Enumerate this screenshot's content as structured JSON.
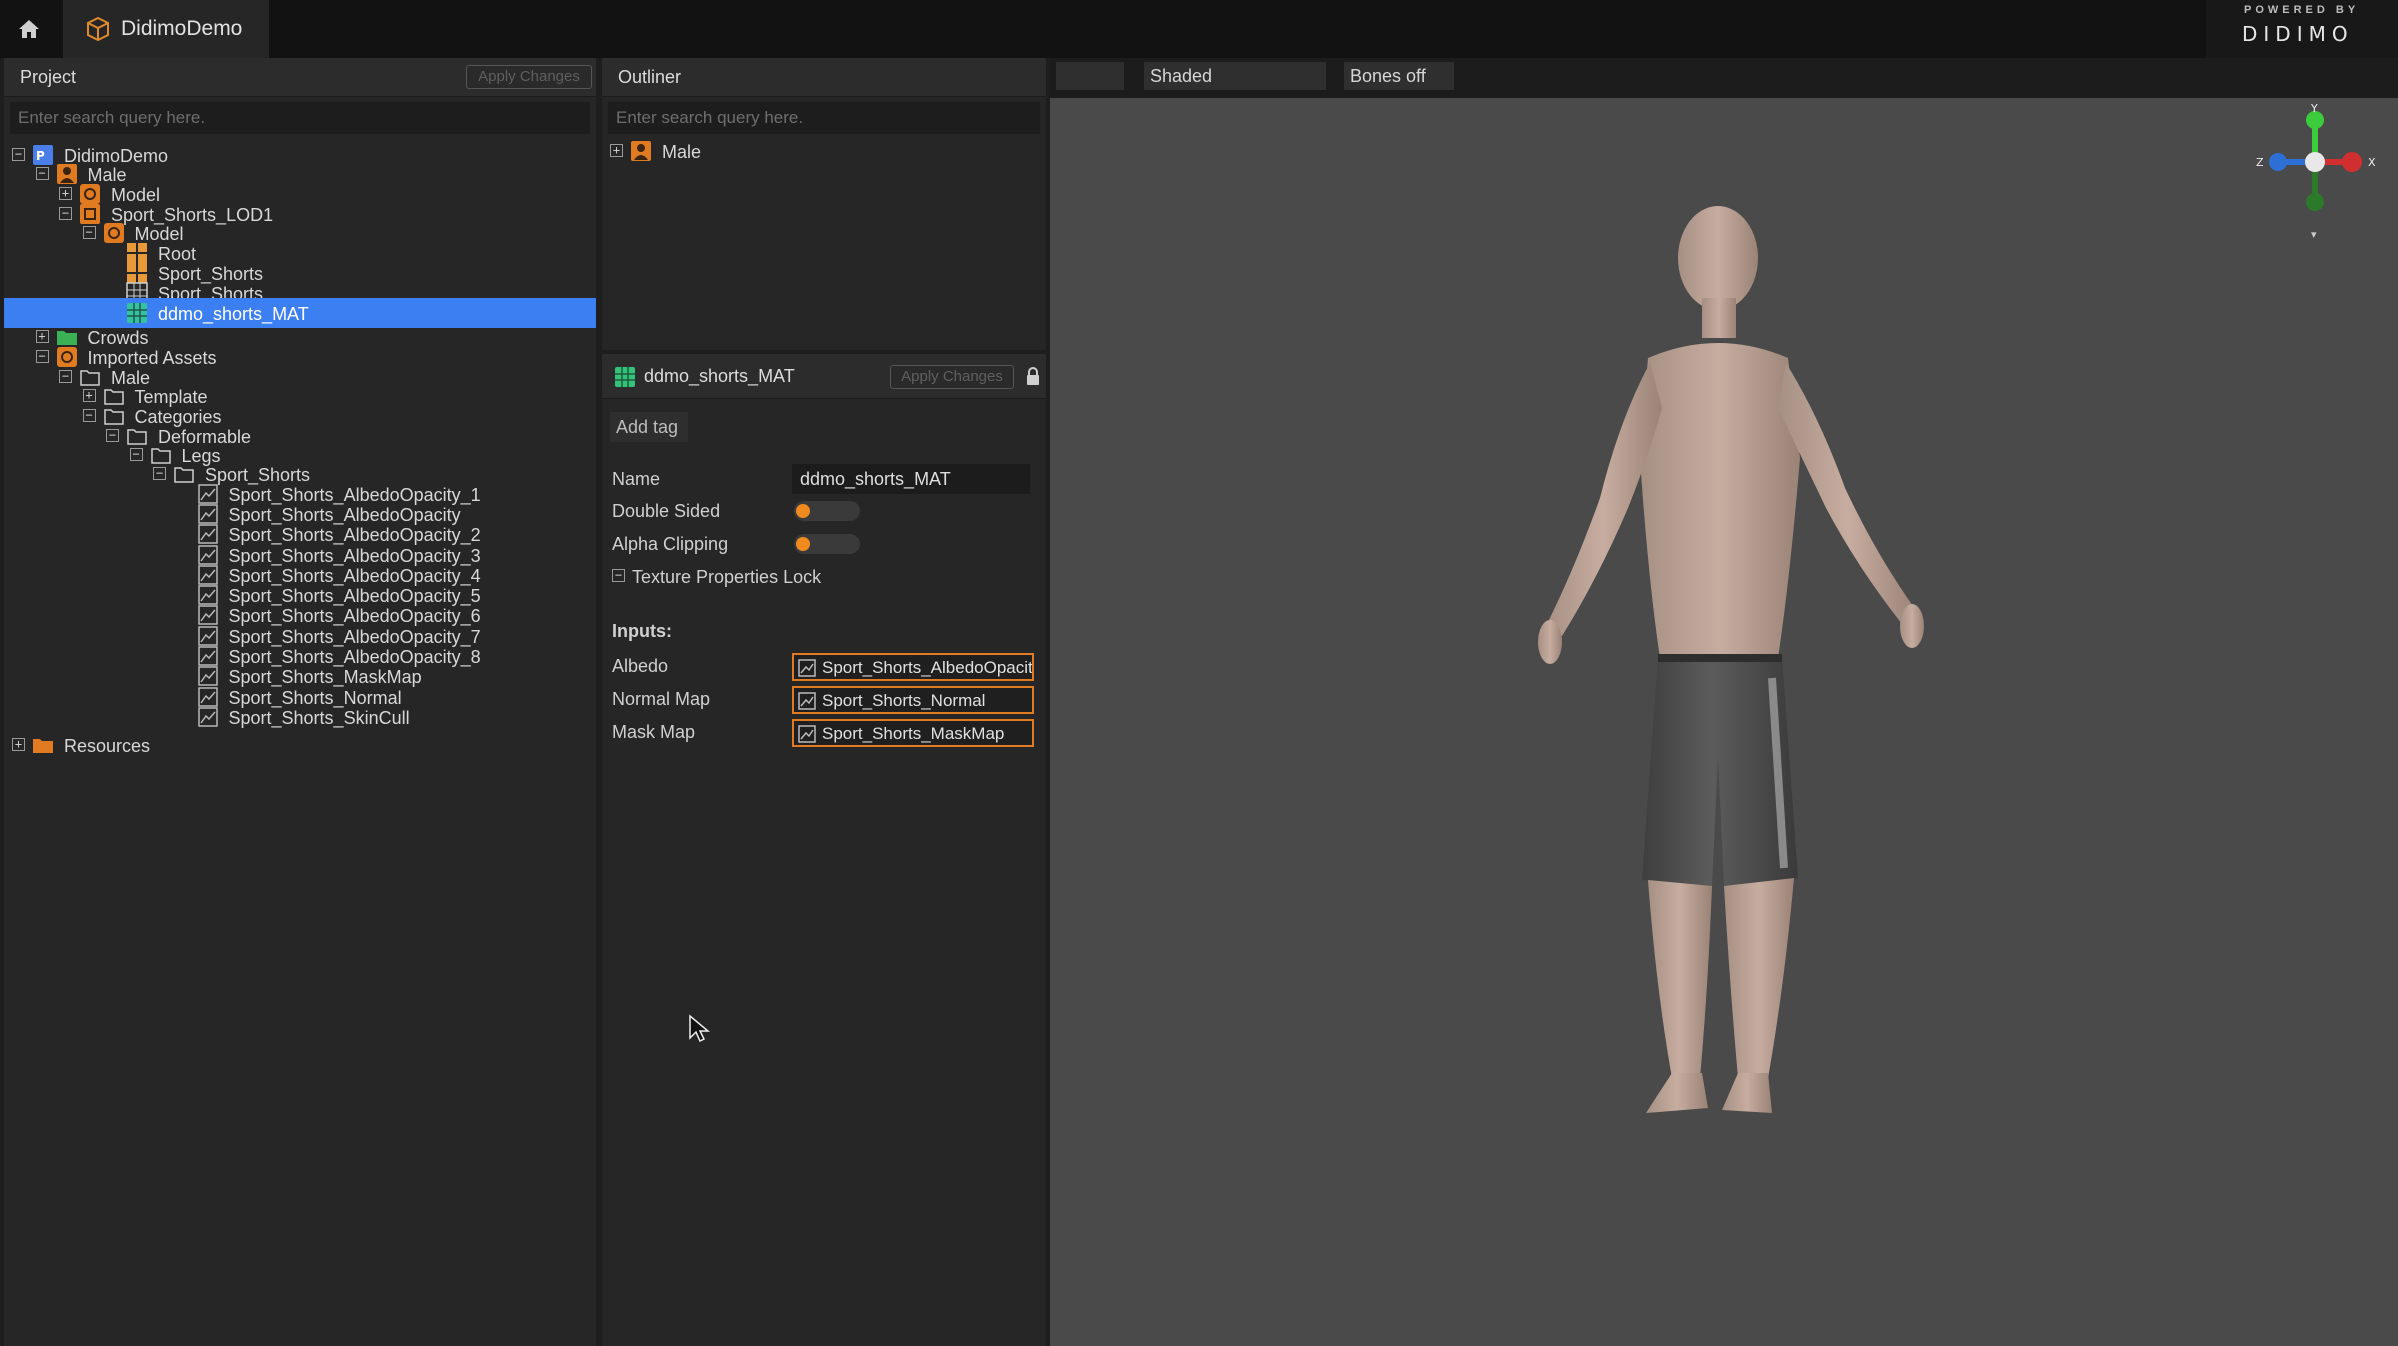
{
  "app": {
    "tab_label": "DidimoDemo",
    "brand_powered": "POWERED BY",
    "brand_logo": "DIDIMO"
  },
  "project": {
    "title": "Project",
    "apply_label": "Apply Changes",
    "search_placeholder": "Enter search query here.",
    "tree": [
      {
        "label": "DidimoDemo",
        "depth": 0,
        "expander": "−",
        "icon": "project-icon"
      },
      {
        "label": "Male",
        "depth": 1,
        "expander": "−",
        "icon": "character-icon"
      },
      {
        "label": "Model",
        "depth": 2,
        "expander": "+",
        "icon": "model-icon"
      },
      {
        "label": "Sport_Shorts_LOD1",
        "depth": 2,
        "expander": "−",
        "icon": "lod-icon"
      },
      {
        "label": "Model",
        "depth": 3,
        "expander": "−",
        "icon": "model-icon"
      },
      {
        "label": "Root",
        "depth": 4,
        "expander": "",
        "icon": "skeleton-icon"
      },
      {
        "label": "Sport_Shorts",
        "depth": 4,
        "expander": "",
        "icon": "skeleton-icon"
      },
      {
        "label": "Sport_Shorts",
        "depth": 4,
        "expander": "",
        "icon": "mesh-icon"
      },
      {
        "label": "ddmo_shorts_MAT",
        "depth": 4,
        "expander": "",
        "icon": "material-icon",
        "selected": true
      },
      {
        "label": "Crowds",
        "depth": 1,
        "expander": "+",
        "icon": "crowd-folder-icon"
      },
      {
        "label": "Imported Assets",
        "depth": 1,
        "expander": "−",
        "icon": "imported-assets-icon"
      },
      {
        "label": "Male",
        "depth": 2,
        "expander": "−",
        "icon": "folder-icon"
      },
      {
        "label": "Template",
        "depth": 3,
        "expander": "+",
        "icon": "folder-icon"
      },
      {
        "label": "Categories",
        "depth": 3,
        "expander": "−",
        "icon": "folder-icon"
      },
      {
        "label": "Deformable",
        "depth": 4,
        "expander": "−",
        "icon": "folder-icon"
      },
      {
        "label": "Legs",
        "depth": 5,
        "expander": "−",
        "icon": "folder-icon"
      },
      {
        "label": "Sport_Shorts",
        "depth": 6,
        "expander": "−",
        "icon": "folder-icon"
      },
      {
        "label": "Sport_Shorts_AlbedoOpacity_1",
        "depth": 7,
        "expander": "",
        "icon": "texture-icon"
      },
      {
        "label": "Sport_Shorts_AlbedoOpacity",
        "depth": 7,
        "expander": "",
        "icon": "texture-icon"
      },
      {
        "label": "Sport_Shorts_AlbedoOpacity_2",
        "depth": 7,
        "expander": "",
        "icon": "texture-icon"
      },
      {
        "label": "Sport_Shorts_AlbedoOpacity_3",
        "depth": 7,
        "expander": "",
        "icon": "texture-icon"
      },
      {
        "label": "Sport_Shorts_AlbedoOpacity_4",
        "depth": 7,
        "expander": "",
        "icon": "texture-icon"
      },
      {
        "label": "Sport_Shorts_AlbedoOpacity_5",
        "depth": 7,
        "expander": "",
        "icon": "texture-icon"
      },
      {
        "label": "Sport_Shorts_AlbedoOpacity_6",
        "depth": 7,
        "expander": "",
        "icon": "texture-icon"
      },
      {
        "label": "Sport_Shorts_AlbedoOpacity_7",
        "depth": 7,
        "expander": "",
        "icon": "texture-icon"
      },
      {
        "label": "Sport_Shorts_AlbedoOpacity_8",
        "depth": 7,
        "expander": "",
        "icon": "texture-icon"
      },
      {
        "label": "Sport_Shorts_MaskMap",
        "depth": 7,
        "expander": "",
        "icon": "texture-icon"
      },
      {
        "label": "Sport_Shorts_Normal",
        "depth": 7,
        "expander": "",
        "icon": "texture-icon"
      },
      {
        "label": "Sport_Shorts_SkinCull",
        "depth": 7,
        "expander": "",
        "icon": "texture-icon"
      },
      {
        "label": "Resources",
        "depth": 0,
        "expander": "+",
        "icon": "resources-folder-icon"
      }
    ]
  },
  "outliner": {
    "title": "Outliner",
    "search_placeholder": "Enter search query here.",
    "items": [
      {
        "label": "Male",
        "expander": "+",
        "icon": "character-icon"
      }
    ]
  },
  "inspector": {
    "title": "ddmo_shorts_MAT",
    "apply_label": "Apply Changes",
    "add_tag": "Add tag",
    "name_label": "Name",
    "name_value": "ddmo_shorts_MAT",
    "double_sided_label": "Double Sided",
    "alpha_clipping_label": "Alpha Clipping",
    "texture_lock_label": "Texture Properties Lock",
    "inputs_heading": "Inputs:",
    "inputs": [
      {
        "label": "Albedo",
        "value": "Sport_Shorts_AlbedoOpacity"
      },
      {
        "label": "Normal Map",
        "value": "Sport_Shorts_Normal"
      },
      {
        "label": "Mask Map",
        "value": "Sport_Shorts_MaskMap"
      }
    ]
  },
  "viewport": {
    "shading_mode": "Shaded",
    "bones_mode": "Bones off",
    "gizmo": {
      "y": "Y",
      "z": "Z",
      "x": "X"
    }
  },
  "colors": {
    "accent": "#3b7ff2",
    "orange": "#e07b22",
    "viewport_bg": "#4a4a4a"
  }
}
